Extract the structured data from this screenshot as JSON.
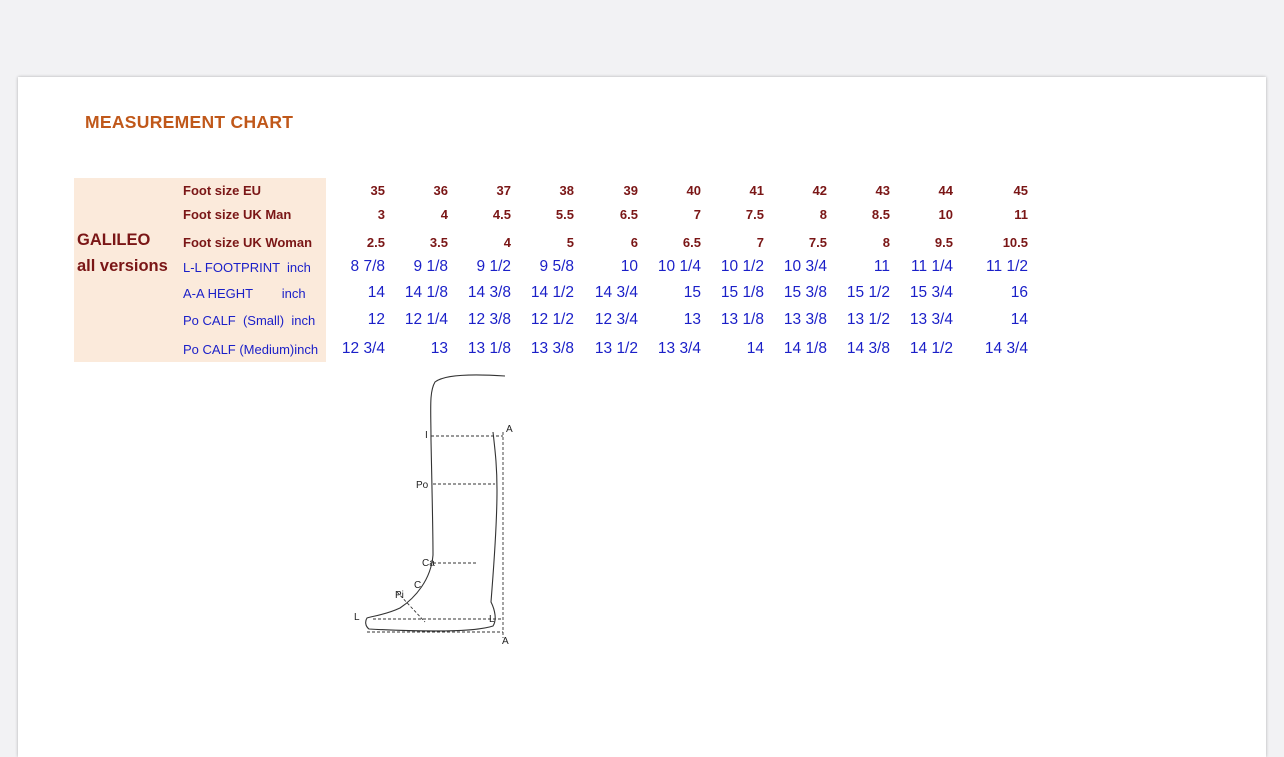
{
  "title": "MEASUREMENT CHART",
  "brand": {
    "line1": "GALILEO",
    "line2": "all versions"
  },
  "rows": [
    {
      "label": "Foot size EU",
      "style": "red",
      "values": [
        "35",
        "36",
        "37",
        "38",
        "39",
        "40",
        "41",
        "42",
        "43",
        "44",
        "45"
      ]
    },
    {
      "label": "Foot size UK Man",
      "style": "red",
      "values": [
        "3",
        "4",
        "4.5",
        "5.5",
        "6.5",
        "7",
        "7.5",
        "8",
        "8.5",
        "10",
        "11"
      ]
    },
    {
      "label": "Foot size UK Woman",
      "style": "red",
      "values": [
        "2.5",
        "3.5",
        "4",
        "5",
        "6",
        "6.5",
        "7",
        "7.5",
        "8",
        "9.5",
        "10.5"
      ]
    },
    {
      "label": "L-L FOOTPRINT  inch",
      "style": "blue",
      "values": [
        "8 7/8",
        "9 1/8",
        "9 1/2",
        "9 5/8",
        "10",
        "10 1/4",
        "10 1/2",
        "10 3/4",
        "11",
        "11 1/4",
        "11 1/2"
      ]
    },
    {
      "label": "A-A HEGHT        inch",
      "style": "blue",
      "values": [
        "14",
        "14 1/8",
        "14 3/8",
        "14 1/2",
        "14 3/4",
        "15",
        "15 1/8",
        "15 3/8",
        "15 1/2",
        "15 3/4",
        "16"
      ]
    },
    {
      "label": "Po CALF  (Small)  inch",
      "style": "blue",
      "values": [
        "12",
        "12 1/4",
        "12 3/8",
        "12 1/2",
        "12 3/4",
        "13",
        "13 1/8",
        "13 3/8",
        "13 1/2",
        "13 3/4",
        "14"
      ]
    },
    {
      "label": "Po CALF (Medium)inch",
      "style": "blue",
      "values": [
        "12 3/4",
        "13",
        "13 1/8",
        "13 3/8",
        "13 1/2",
        "13 3/4",
        "14",
        "14 1/8",
        "14 3/8",
        "14 1/2",
        "14 3/4"
      ]
    }
  ],
  "diagram": {
    "markers": {
      "I": "I",
      "A_top": "A",
      "Po": "Po",
      "Ca": "Ca",
      "C": "C",
      "Pi": "Pi",
      "L_left": "L",
      "L_right": "L",
      "A_bottom": "A"
    }
  }
}
